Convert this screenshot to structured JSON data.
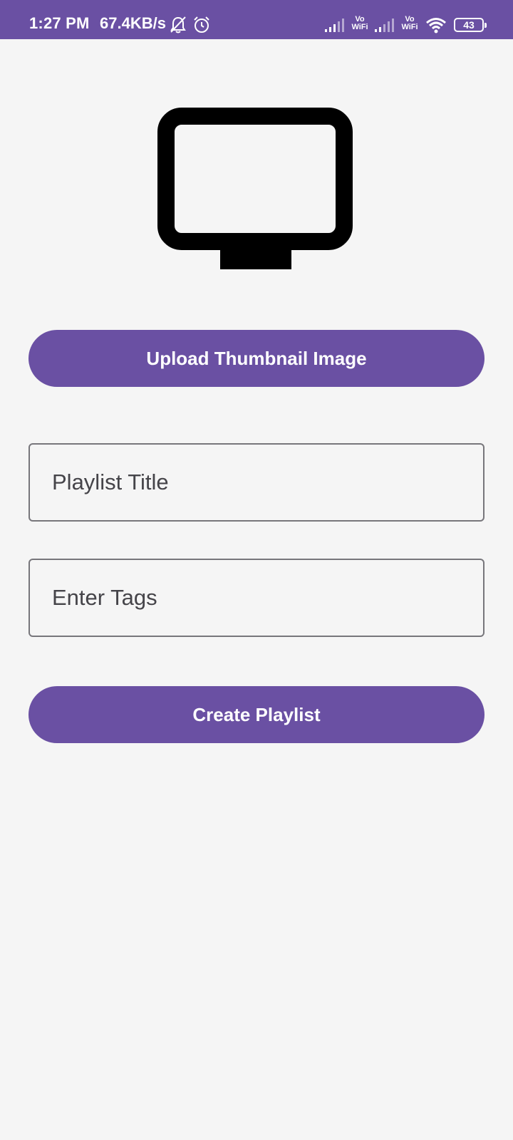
{
  "status_bar": {
    "time": "1:27 PM",
    "speed": "67.4KB/s",
    "vo_label_1": "Vo",
    "wifi_label_1": "WiFi",
    "vo_label_2": "Vo",
    "wifi_label_2": "WiFi",
    "battery": "43",
    "icons": [
      "mute-bell-icon",
      "alarm-icon",
      "signal-icon",
      "signal-icon",
      "wifi-icon",
      "battery-icon"
    ]
  },
  "thumbnail": {
    "icon": "tv-icon"
  },
  "upload_button": {
    "label": "Upload Thumbnail Image"
  },
  "title_field": {
    "placeholder": "Playlist Title"
  },
  "tags_field": {
    "placeholder": "Enter Tags"
  },
  "create_button": {
    "label": "Create Playlist"
  },
  "colors": {
    "accent": "#6a50a3",
    "background": "#f5f5f5",
    "field_border": "#77767b",
    "placeholder": "#454449"
  }
}
